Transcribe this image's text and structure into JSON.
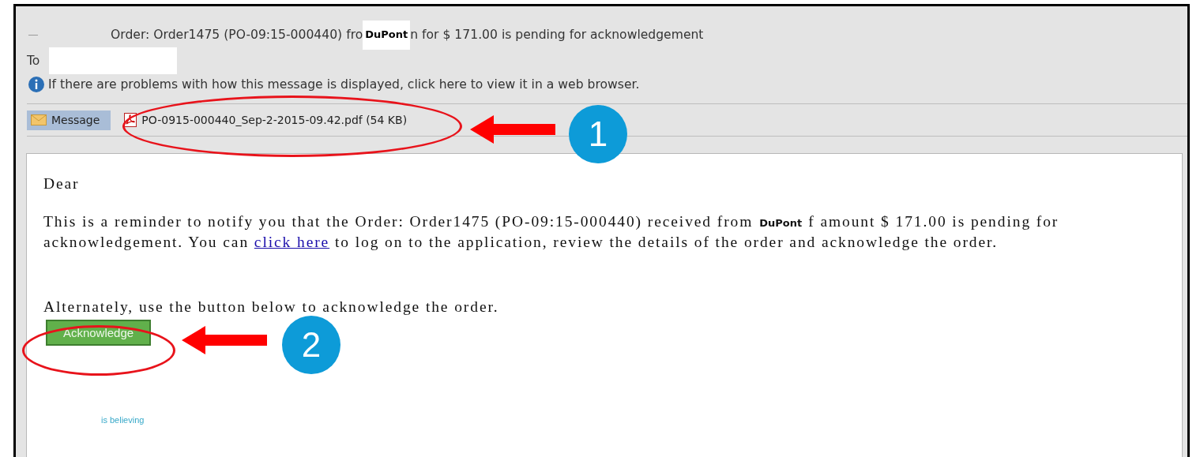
{
  "email": {
    "subject": {
      "before": "Order: Order1475 (PO-09:15-000440) fro",
      "redaction": "DuPont",
      "after": "n for $ 171.00 is pending for acknowledgement"
    },
    "to_label": "To",
    "info": "If there are problems with how this message is displayed, click here to view it in a web browser.",
    "tabs": [
      {
        "label": "Message",
        "kind": "message",
        "selected": true
      },
      {
        "label": "PO-0915-000440_Sep-2-2015-09.42.pdf (54 KB)",
        "kind": "attachment",
        "selected": false
      }
    ],
    "body": {
      "greeting": "Dear",
      "line_1": {
        "before": "This is a reminder to notify you that the Order: Order1475 (PO-09:15-000440) received from",
        "redaction": "DuPont",
        "after": "f amount $ 171.00 is pending for"
      },
      "line_2": {
        "before": "acknowledgement. You can",
        "link": "click here",
        "after": "to log on to the application, review the details of the order and acknowledge the order."
      },
      "alternate": "Alternately, use the button below to acknowledge the order.",
      "button": "Acknowledge",
      "fragment": "is believing"
    }
  },
  "callouts": [
    {
      "label": "1"
    },
    {
      "label": "2"
    }
  ]
}
